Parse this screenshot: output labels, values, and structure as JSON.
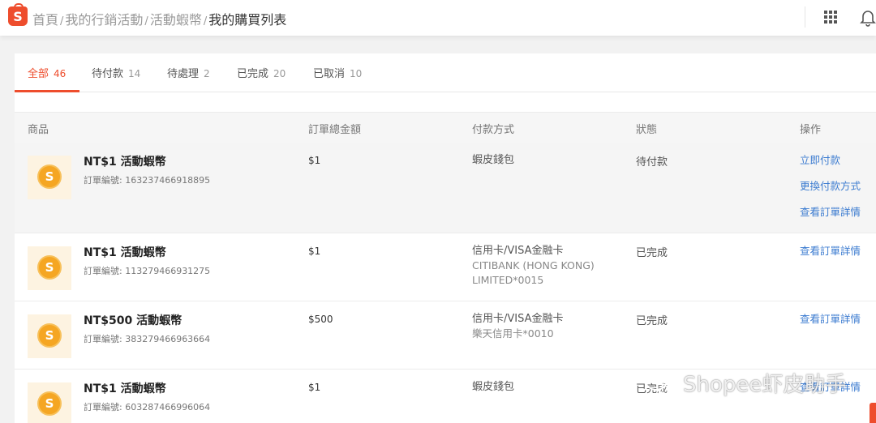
{
  "brand": {
    "logo_letter": "S",
    "color": "#ee4d2d"
  },
  "breadcrumb": {
    "items": [
      "首頁",
      "我的行銷活動",
      "活動蝦幣"
    ],
    "separator": "/",
    "current": "我的購買列表"
  },
  "topbar": {
    "apps_icon": "grid-icon",
    "notification_icon": "bell-icon"
  },
  "tabs": [
    {
      "label": "全部",
      "count": "46",
      "active": true
    },
    {
      "label": "待付款",
      "count": "14"
    },
    {
      "label": "待處理",
      "count": "2"
    },
    {
      "label": "已完成",
      "count": "20"
    },
    {
      "label": "已取消",
      "count": "10"
    }
  ],
  "table": {
    "headers": {
      "product": "商品",
      "total": "訂單總金額",
      "payment": "付款方式",
      "status": "狀態",
      "actions": "操作"
    },
    "rows": [
      {
        "name": "NT$1 活動蝦幣",
        "order_no": "訂單編號: 163237466918895",
        "amount": "$1",
        "payment": "蝦皮錢包",
        "payment_sub": "",
        "payment_sub2": "",
        "status": "待付款",
        "actions": [
          "立即付款",
          "更換付款方式",
          "查看訂單詳情"
        ]
      },
      {
        "name": "NT$1 活動蝦幣",
        "order_no": "訂單編號: 113279466931275",
        "amount": "$1",
        "payment": "信用卡/VISA金融卡",
        "payment_sub": "CITIBANK (HONG KONG)",
        "payment_sub2": "LIMITED*0015",
        "status": "已完成",
        "actions": [
          "查看訂單詳情"
        ]
      },
      {
        "name": "NT$500 活動蝦幣",
        "order_no": "訂單編號: 383279466963664",
        "amount": "$500",
        "payment": "信用卡/VISA金融卡",
        "payment_sub": "樂天信用卡*0010",
        "payment_sub2": "",
        "status": "已完成",
        "actions": [
          "查看訂單詳情"
        ]
      },
      {
        "name": "NT$1 活動蝦幣",
        "order_no": "訂單編號: 603287466996064",
        "amount": "$1",
        "payment": "蝦皮錢包",
        "payment_sub": "",
        "payment_sub2": "",
        "status": "已完成",
        "actions": [
          "查看訂單詳情"
        ]
      }
    ],
    "coin_icon": "coin-icon",
    "coin_letter": "S"
  },
  "watermark": {
    "text": "Shopee虾皮助手",
    "icon": "wechat-icon"
  },
  "colors": {
    "accent": "#ee4d2d",
    "link": "#3b7bd0",
    "coin": "#f5a623"
  }
}
